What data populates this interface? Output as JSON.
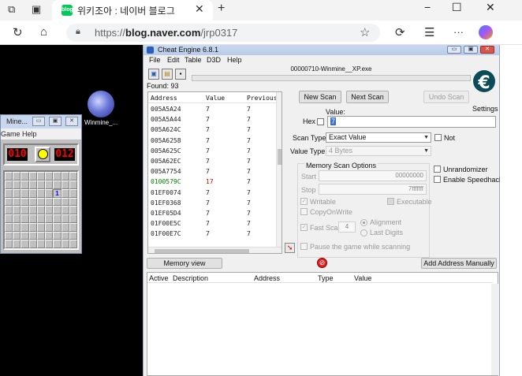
{
  "browser": {
    "tab_title": "위키조아 : 네이버 블로그",
    "tab_favicon": "blog",
    "url_prefix": "https://",
    "url_host": "blog.naver.com",
    "url_path": "/jrp0317",
    "close_tab": "✕",
    "new_tab": "+",
    "minimize": "−",
    "maximize": "☐",
    "close_window": "✕",
    "more": "···",
    "icons": [
      "workspaces-icon",
      "tab-actions-icon",
      "reload-icon",
      "home-icon",
      "lock-icon",
      "favorite-icon",
      "extensions-icon",
      "favorites-icon",
      "more-icon",
      "copilot-icon"
    ]
  },
  "desktop": {
    "icon_label": "Winmine_..."
  },
  "minesweeper": {
    "title": "Mine...",
    "menu": [
      "Game",
      "Help"
    ],
    "mines_left": "010",
    "timer": "012",
    "revealed_number": "1"
  },
  "cheat_engine": {
    "title": "Cheat Engine 6.8.1",
    "menu": [
      "File",
      "Edit",
      "Table",
      "D3D",
      "Help"
    ],
    "process": "00000710-Winmine__XP.exe",
    "found": "Found: 93",
    "settings": "Settings",
    "columns": [
      "Address",
      "Value",
      "Previous"
    ],
    "rows": [
      {
        "address": "005A5A24",
        "value": "7",
        "previous": "7",
        "kind": "normal"
      },
      {
        "address": "005A5A44",
        "value": "7",
        "previous": "7",
        "kind": "normal"
      },
      {
        "address": "005A624C",
        "value": "7",
        "previous": "7",
        "kind": "normal"
      },
      {
        "address": "005A6258",
        "value": "7",
        "previous": "7",
        "kind": "normal"
      },
      {
        "address": "005A625C",
        "value": "7",
        "previous": "7",
        "kind": "normal"
      },
      {
        "address": "005A62EC",
        "value": "7",
        "previous": "7",
        "kind": "normal"
      },
      {
        "address": "005A7754",
        "value": "7",
        "previous": "7",
        "kind": "normal"
      },
      {
        "address": "0100579C",
        "value": "17",
        "previous": "7",
        "kind": "static-changed"
      },
      {
        "address": "01EF0074",
        "value": "7",
        "previous": "7",
        "kind": "normal"
      },
      {
        "address": "01EF0368",
        "value": "7",
        "previous": "7",
        "kind": "normal"
      },
      {
        "address": "01EF05D4",
        "value": "7",
        "previous": "7",
        "kind": "normal"
      },
      {
        "address": "01F00E5C",
        "value": "7",
        "previous": "7",
        "kind": "normal"
      },
      {
        "address": "01F00E7C",
        "value": "7",
        "previous": "7",
        "kind": "normal"
      }
    ],
    "new_scan": "New Scan",
    "next_scan": "Next Scan",
    "undo_scan": "Undo Scan",
    "value_label": "Value:",
    "hex_label": "Hex",
    "value_input": "7",
    "scan_type_label": "Scan Type",
    "scan_type": "Exact Value",
    "value_type_label": "Value Type",
    "value_type": "4 Bytes",
    "not_label": "Not",
    "memory_scan_options": "Memory Scan Options",
    "start_label": "Start",
    "start_value": "00000000",
    "stop_label": "Stop",
    "stop_value": "7fffffff",
    "writable": "Writable",
    "executable": "Executable",
    "copy_on_write": "CopyOnWrite",
    "fast_scan": "Fast Scan",
    "fast_scan_value": "4",
    "alignment": "Alignment",
    "last_digits": "Last Digits",
    "pause_game": "Pause the game while scanning",
    "unrandomizer": "Unrandomizer",
    "enable_speedhack": "Enable Speedhack",
    "memory_view": "Memory view",
    "add_address_manually": "Add Address Manually",
    "list_columns": [
      "Active",
      "Description",
      "Address",
      "Type",
      "Value"
    ],
    "accent_color": "#2a5fb8",
    "changed_value_color": "#d00000",
    "static_address_color": "#008000"
  }
}
